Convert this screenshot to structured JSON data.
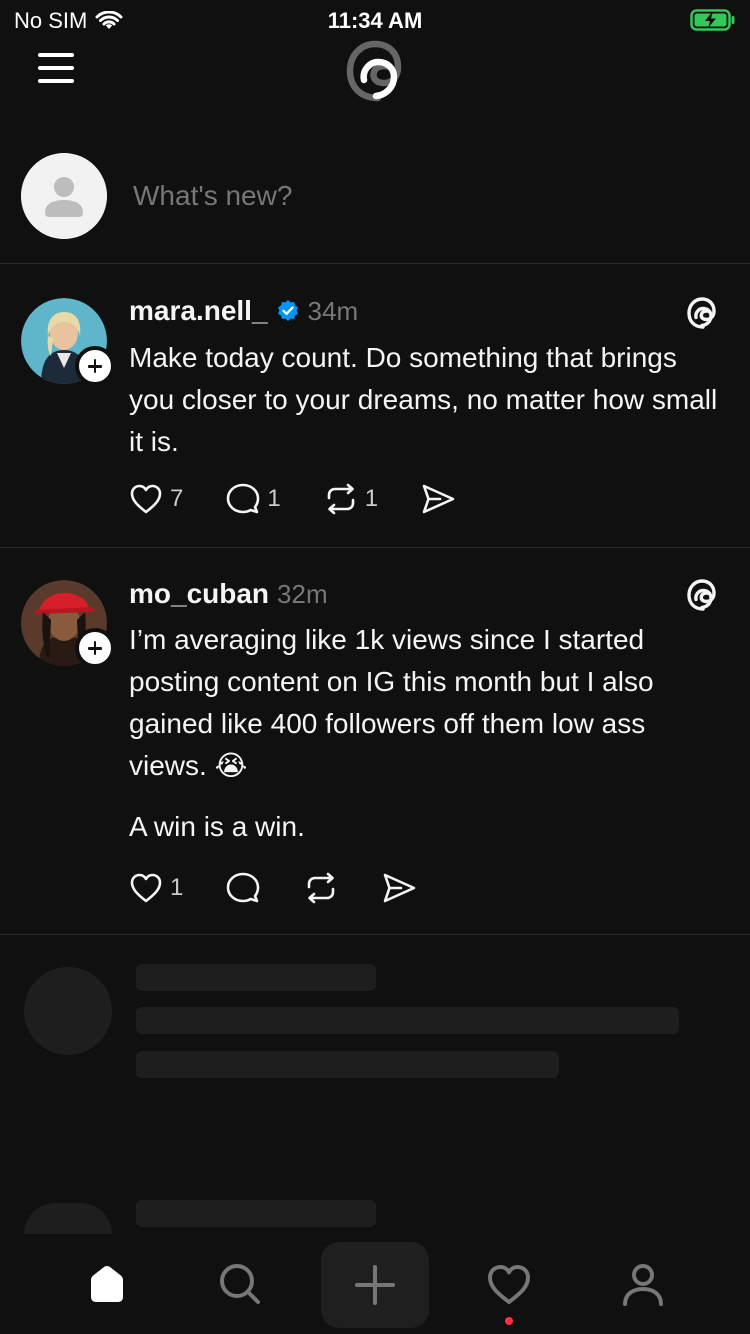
{
  "status": {
    "carrier": "No SIM",
    "time": "11:34 AM"
  },
  "composer": {
    "placeholder": "What's new?"
  },
  "posts": [
    {
      "username": "mara.nell_",
      "verified": true,
      "time": "34m",
      "text": "Make today count. Do something that brings you closer to your dreams, no matter how small it is.",
      "likes": "7",
      "replies": "1",
      "reposts": "1"
    },
    {
      "username": "mo_cuban",
      "verified": false,
      "time": "32m",
      "text": "I’m averaging like 1k views since I started posting content on IG this month but I also gained like 400 followers off them low ass views. 😭",
      "text2": "A win is a win.",
      "likes": "1",
      "replies": "",
      "reposts": ""
    }
  ],
  "tabbar": {
    "items": [
      "home-icon",
      "search-icon",
      "create-icon",
      "activity-icon",
      "profile-icon"
    ],
    "active": "home-icon",
    "notification_dot_color": "#ff3040"
  },
  "colors": {
    "background": "#101010",
    "verified": "#0095f6",
    "battery": "#34c759"
  }
}
